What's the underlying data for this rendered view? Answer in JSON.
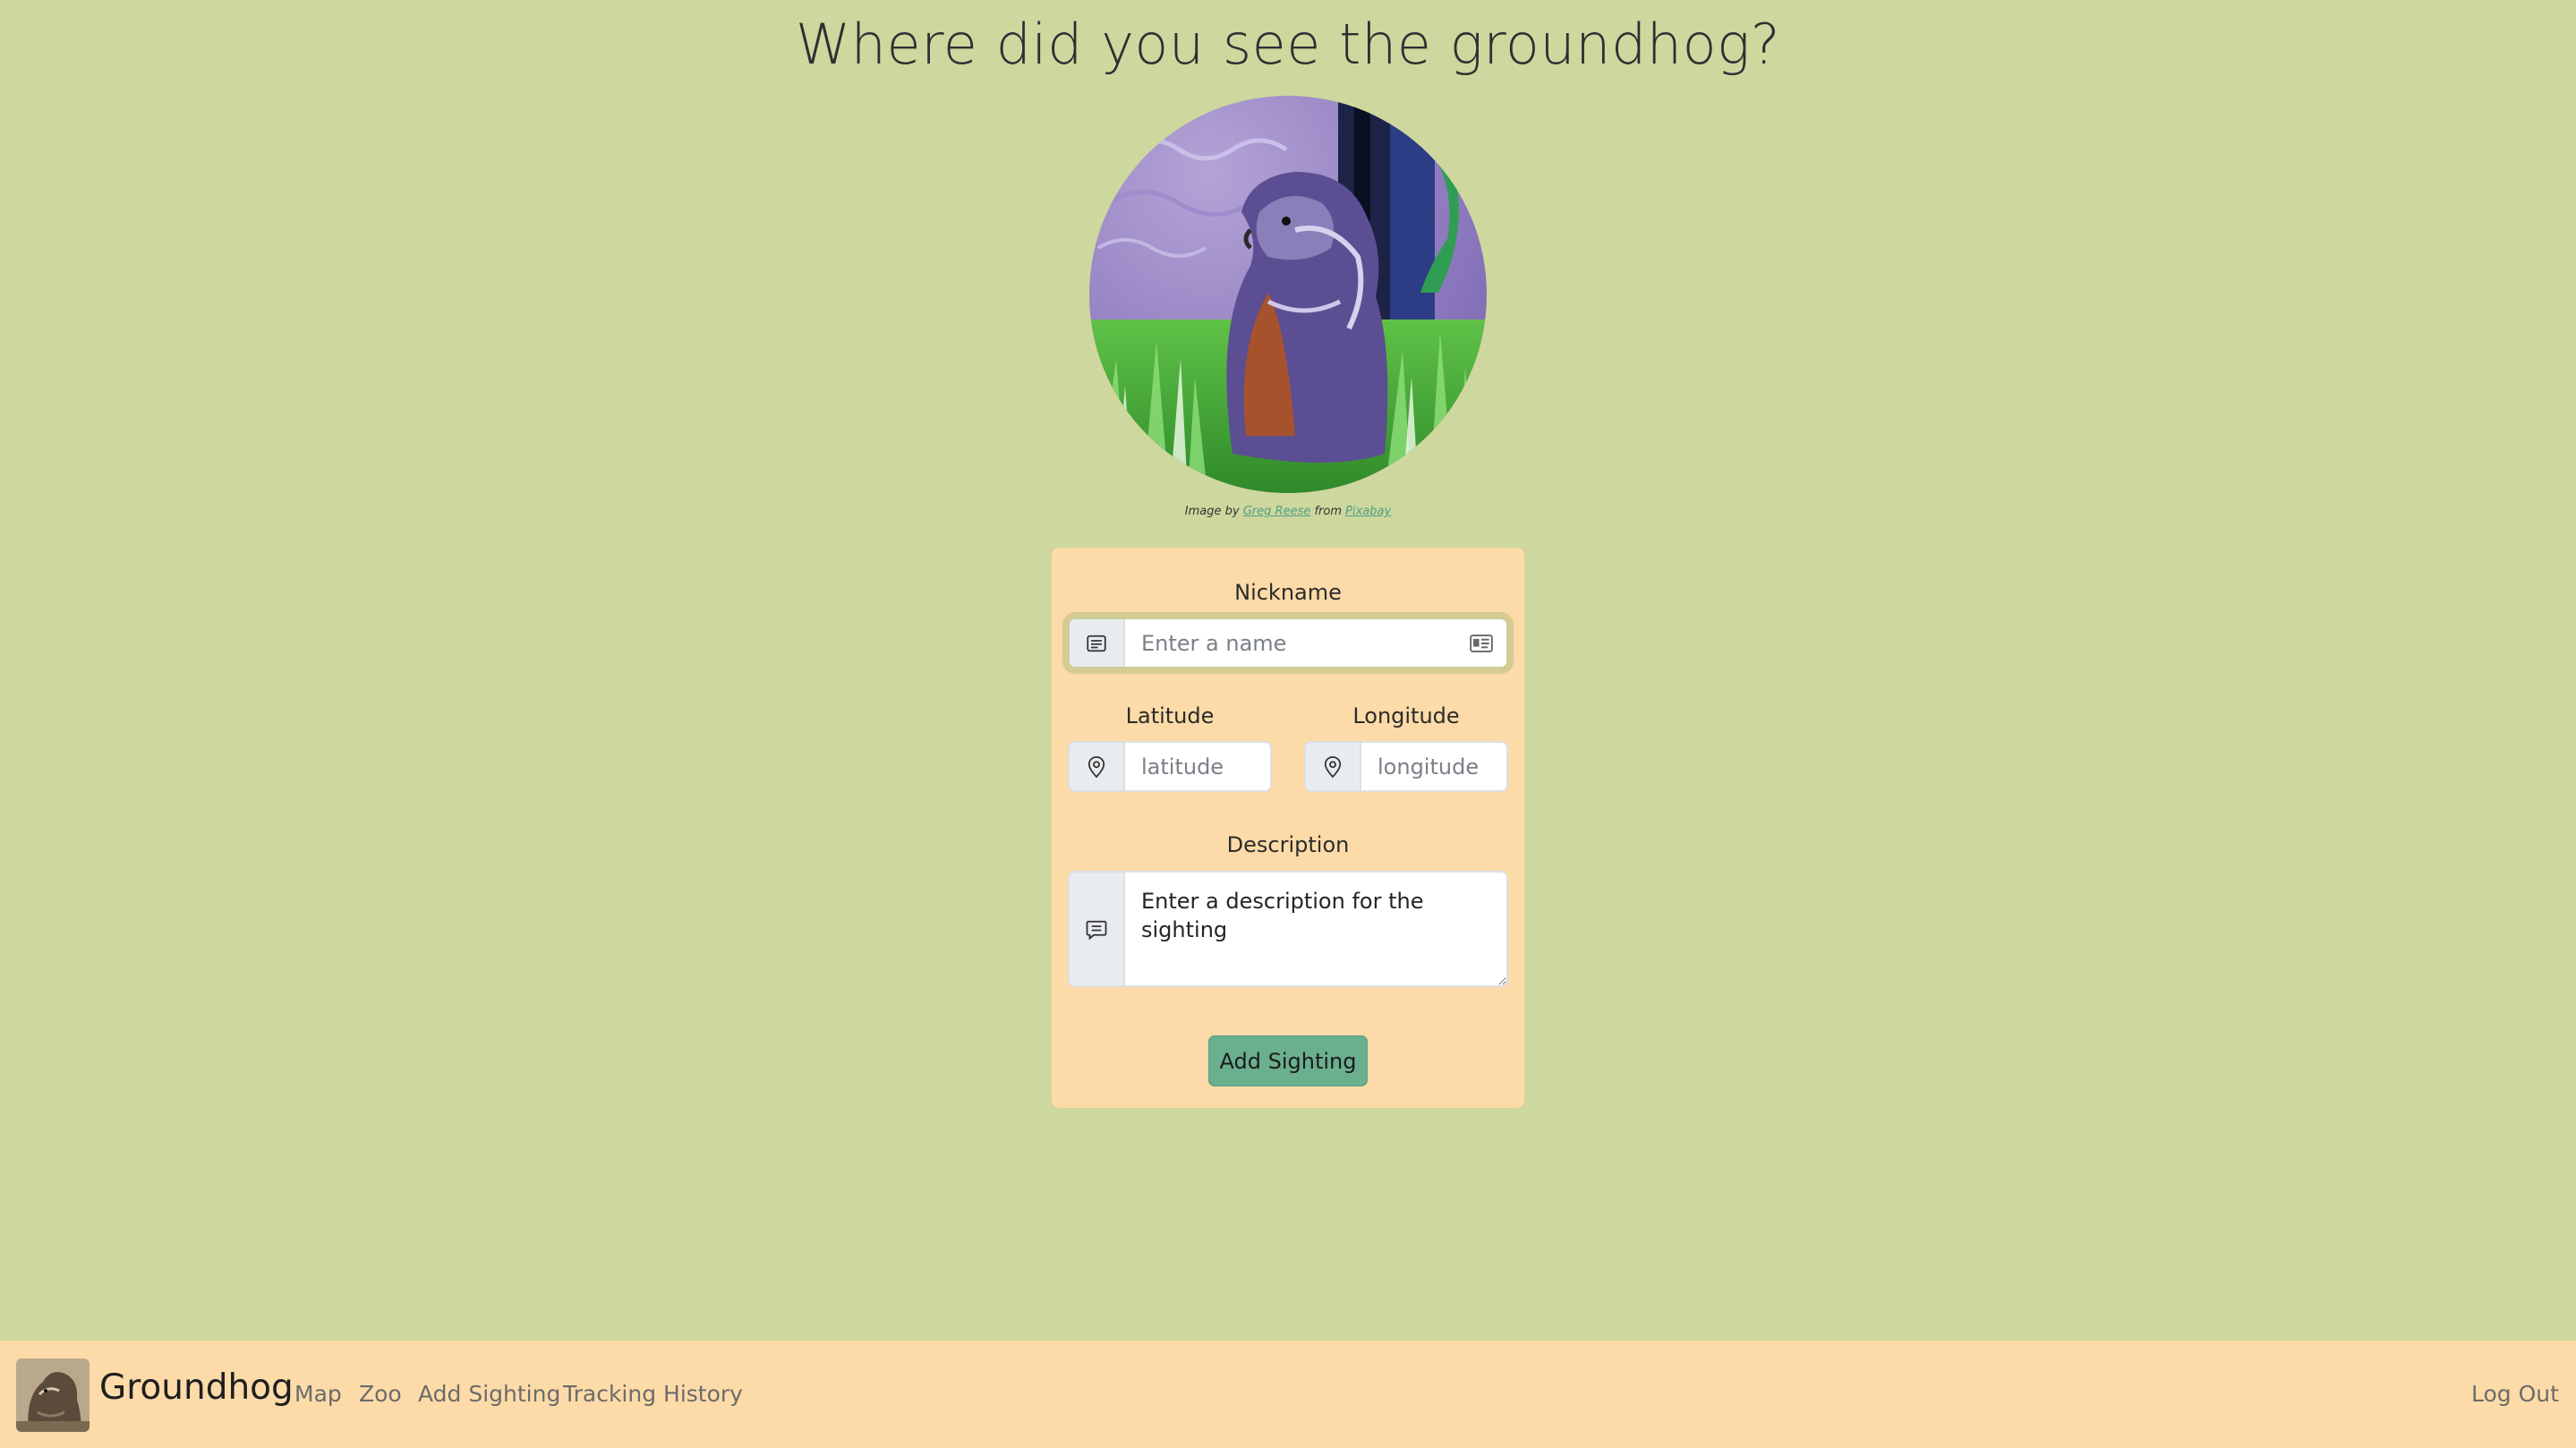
{
  "page": {
    "heading": "Where did you see the groundhog?"
  },
  "photo": {
    "subject": "groundhog-painting",
    "credit_prefix": "Image by",
    "credit_author": "Greg Reese",
    "credit_middle": "from",
    "credit_source": "Pixabay"
  },
  "form": {
    "nickname": {
      "label": "Nickname",
      "placeholder": "Enter a name",
      "value": "",
      "icon": "card-text-icon",
      "trailing_icon": "contact-card-icon"
    },
    "latitude": {
      "label": "Latitude",
      "placeholder": "latitude",
      "value": "",
      "icon": "map-pin-icon"
    },
    "longitude": {
      "label": "Longitude",
      "placeholder": "longitude",
      "value": "",
      "icon": "map-pin-icon"
    },
    "description": {
      "label": "Description",
      "placeholder": "Enter a description for the sighting",
      "value": "",
      "icon": "chat-lines-icon"
    },
    "submit_label": "Add Sighting"
  },
  "navbar": {
    "brand": "Groundhog",
    "links": [
      {
        "label": "Map"
      },
      {
        "label": "Zoo"
      },
      {
        "label": "Add Sighting"
      },
      {
        "label": "Tracking History"
      }
    ],
    "logout_label": "Log Out"
  },
  "colors": {
    "page_background": "#ced79d",
    "card_background": "#fddba8",
    "button_background": "#6aaf8e",
    "link_color": "#4f9f86"
  }
}
